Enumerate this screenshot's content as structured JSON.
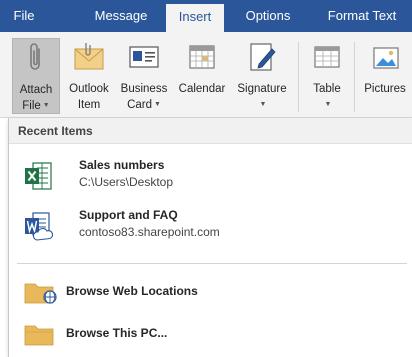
{
  "tabs": [
    {
      "label": "File",
      "active": false
    },
    {
      "label": "Message",
      "active": false
    },
    {
      "label": "Insert",
      "active": true
    },
    {
      "label": "Options",
      "active": false
    },
    {
      "label": "Format Text",
      "active": false
    }
  ],
  "ribbon": {
    "attach_file": {
      "line1": "Attach",
      "line2": "File",
      "icon": "paperclip-icon"
    },
    "outlook_item": {
      "line1": "Outlook",
      "line2": "Item",
      "icon": "envelope-icon"
    },
    "business_card": {
      "line1": "Business",
      "line2": "Card",
      "icon": "business-card-icon"
    },
    "calendar": {
      "line1": "Calendar",
      "line2": "",
      "icon": "calendar-icon"
    },
    "signature": {
      "line1": "Signature",
      "line2": "",
      "icon": "signature-pen-icon"
    },
    "table": {
      "line1": "Table",
      "line2": "",
      "icon": "table-icon"
    },
    "pictures": {
      "line1": "Pictures",
      "line2": "",
      "icon": "picture-icon"
    }
  },
  "dropdown": {
    "section_title": "Recent Items",
    "recent_items": [
      {
        "name": "Sales numbers",
        "path": "C:\\Users\\Desktop",
        "icon": "excel-file-icon"
      },
      {
        "name": "Support and FAQ",
        "path": "contoso83.sharepoint.com",
        "icon": "word-file-icon"
      }
    ],
    "browse_items": [
      {
        "label": "Browse Web Locations",
        "icon": "folder-globe-icon"
      },
      {
        "label": "Browse This PC...",
        "icon": "folder-icon"
      }
    ]
  },
  "colors": {
    "tab_bar": "#2b579a",
    "ribbon_bg": "#f3f3f3",
    "excel_green": "#217346",
    "word_blue": "#2b579a",
    "folder_yellow": "#e8b85a"
  }
}
